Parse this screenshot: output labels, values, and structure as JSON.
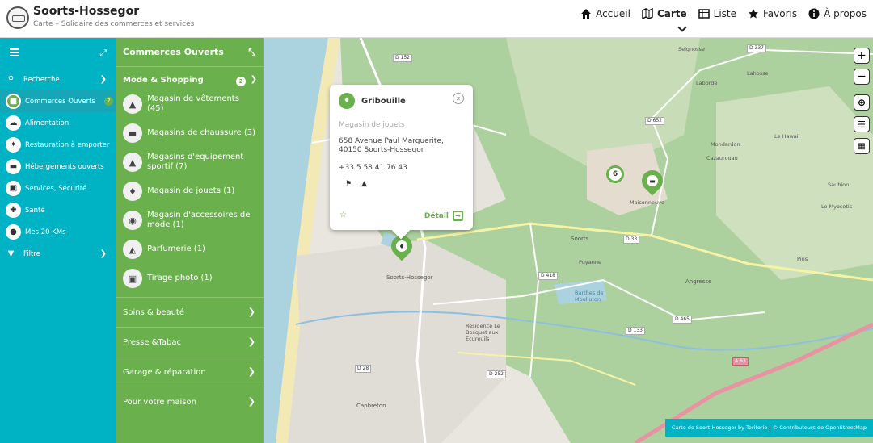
{
  "header": {
    "title": "Soorts-Hossegor",
    "subtitle": "Carte – Solidaire des commerces et services",
    "nav": [
      {
        "label": "Accueil",
        "icon": "home-icon"
      },
      {
        "label": "Carte",
        "icon": "map-icon"
      },
      {
        "label": "Liste",
        "icon": "list-icon"
      },
      {
        "label": "Favoris",
        "icon": "star-icon"
      },
      {
        "label": "À propos",
        "icon": "info-icon"
      }
    ]
  },
  "sidebar": {
    "items": [
      {
        "label": "Recherche",
        "icon": "search-icon"
      },
      {
        "label": "Commerces Ouverts",
        "icon": "shop-icon",
        "badge": "2"
      },
      {
        "label": "Alimentation",
        "icon": "basket-icon"
      },
      {
        "label": "Restauration à emporter",
        "icon": "cutlery-icon"
      },
      {
        "label": "Hébergements ouverts",
        "icon": "bed-icon"
      },
      {
        "label": "Services, Sécurité",
        "icon": "building-icon"
      },
      {
        "label": "Santé",
        "icon": "health-icon"
      },
      {
        "label": "Mes 20 KMs",
        "icon": "person-icon"
      },
      {
        "label": "Filtre",
        "icon": "filter-icon"
      }
    ]
  },
  "panel": {
    "title": "Commerces Ouverts",
    "group": {
      "label": "Mode & Shopping",
      "badge": "2"
    },
    "categories": [
      {
        "label": "Magasin de vêtements (45)",
        "icon": "shirt-icon"
      },
      {
        "label": "Magasins de chaussure (3)",
        "icon": "shoe-icon"
      },
      {
        "label": "Magasins d'equipement sportif (7)",
        "icon": "sport-icon"
      },
      {
        "label": "Magasin de jouets (1)",
        "icon": "toy-icon"
      },
      {
        "label": "Magasin d'accessoires de mode (1)",
        "icon": "glasses-icon"
      },
      {
        "label": "Parfumerie (1)",
        "icon": "perfume-icon"
      },
      {
        "label": "Tirage photo (1)",
        "icon": "camera-icon"
      }
    ],
    "sections": [
      "Soins & beauté",
      "Presse &Tabac",
      "Garage & réparation",
      "Pour votre maison"
    ]
  },
  "map": {
    "labels": {
      "seignosse": "Seignosse",
      "soorts": "Soorts",
      "hossegor": "Soorts-Hossegor",
      "angresse": "Angresse",
      "capbreton": "Capbreton",
      "puyanne": "Puyanne",
      "saubion": "Saubion",
      "maisonneuve": "Maisonneuve",
      "lahosse": "Lahosse",
      "laborde": "Laborde",
      "ls_hawaii": "Le Hawaii",
      "mondardon": "Mondardon",
      "cazaurouau": "Cazaurouau",
      "lemyosotis": "Le Myosotis",
      "pins": "Pins",
      "residence": "Résidence Le Bosquet aux Écureuils",
      "etang": "Barthes de Mouliuton"
    },
    "roads": [
      "D 152",
      "D 337",
      "D 652",
      "D 33",
      "D 418",
      "D 133",
      "D 465",
      "D 28",
      "D 252",
      "A 63"
    ],
    "cluster_count": "6",
    "attribution": "Carte de Soort-Hossegor by Teritorio | © Contributeurs de OpenStreetMap"
  },
  "popup": {
    "name": "Gribouille",
    "category": "Magasin de jouets",
    "address_line1": "658 Avenue Paul Marguerite,",
    "address_line2": "40150 Soorts-Hossegor",
    "phone": "+33 5 58 41 76 43",
    "detail_label": "Détail",
    "close_label": "x"
  },
  "colors": {
    "sidebar": "#00b3c4",
    "panel": "#6ab04c",
    "accent": "#6ab04c"
  }
}
